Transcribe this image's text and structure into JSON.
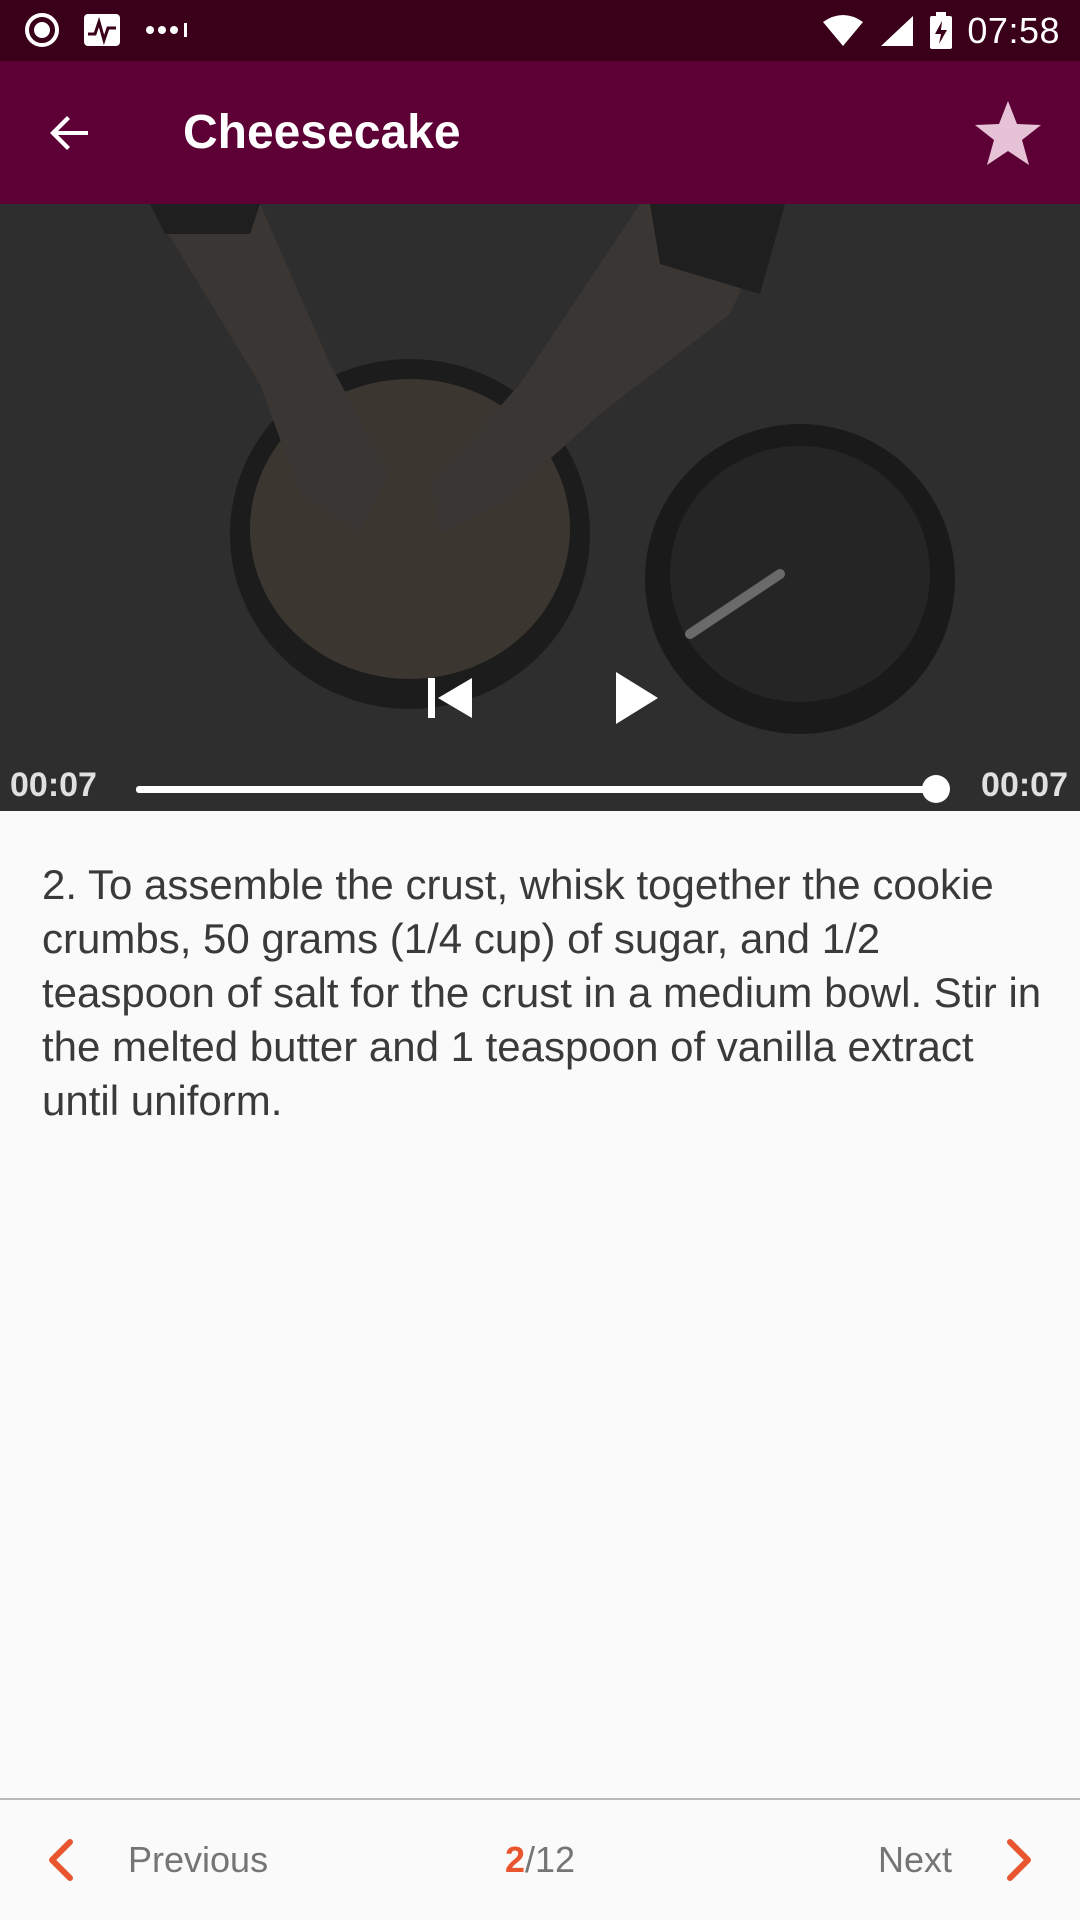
{
  "status_bar": {
    "time": "07:58",
    "icons": [
      "record-icon",
      "activity-icon",
      "more-dots-icon",
      "wifi-icon",
      "signal-icon",
      "battery-charging-icon"
    ]
  },
  "app_bar": {
    "title": "Cheesecake",
    "back_icon": "arrow-back-icon",
    "favorite_icon": "star-icon",
    "color": "#5d0036"
  },
  "video": {
    "elapsed": "00:07",
    "duration": "00:07",
    "progress": 1.0,
    "controls": [
      "skip-previous-icon",
      "play-icon"
    ]
  },
  "step": {
    "text": "2. To assemble the crust, whisk together the cookie crumbs, 50 grams (1/4 cup) of sugar, and 1/2 teaspoon of salt for the crust in a medium bowl. Stir in the melted butter and 1 teaspoon of vanilla extract until uniform."
  },
  "navigation": {
    "previous_label": "Previous",
    "next_label": "Next",
    "current_page": "2",
    "total_pages": "/12",
    "accent_color": "#e8552f"
  }
}
